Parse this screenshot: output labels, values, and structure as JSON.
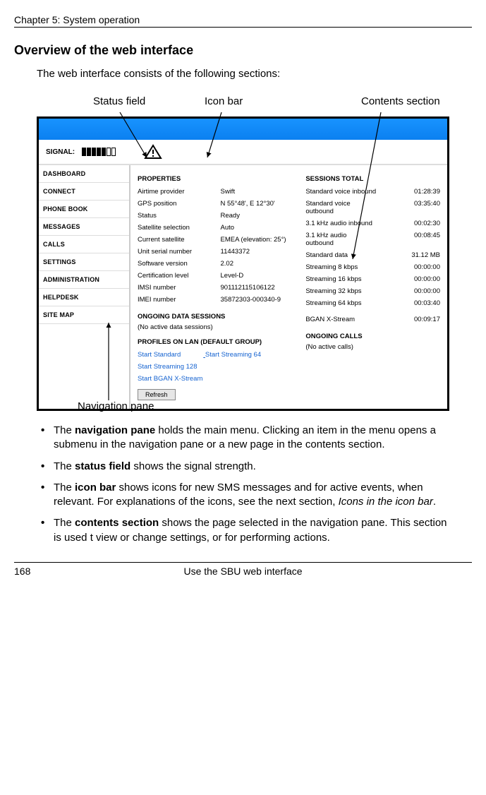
{
  "header": {
    "chapter": "Chapter 5:  System operation"
  },
  "heading": "Overview of the web interface",
  "intro": "The web interface consists of the following sections:",
  "callouts": {
    "status": "Status field",
    "iconbar": "Icon bar",
    "contents": "Contents section",
    "navpane": "Navigation pane"
  },
  "ui": {
    "signal_label": "SIGNAL:",
    "nav": [
      "DASHBOARD",
      "CONNECT",
      "PHONE BOOK",
      "MESSAGES",
      "CALLS",
      "SETTINGS",
      "ADMINISTRATION",
      "HELPDESK",
      "SITE MAP"
    ],
    "properties": {
      "header": "PROPERTIES",
      "rows": [
        {
          "k": "Airtime provider",
          "v": "Swift"
        },
        {
          "k": "GPS position",
          "v": "N 55°48', E 12°30'"
        },
        {
          "k": "Status",
          "v": "Ready"
        },
        {
          "k": "Satellite selection",
          "v": "Auto"
        },
        {
          "k": "Current satellite",
          "v": "EMEA (elevation: 25°)"
        },
        {
          "k": "Unit serial number",
          "v": "11443372"
        },
        {
          "k": "Software version",
          "v": "2.02"
        },
        {
          "k": "Certification level",
          "v": "Level-D"
        },
        {
          "k": "IMSI number",
          "v": "901112115106122"
        },
        {
          "k": "IMEI number",
          "v": "35872303-000340-9"
        }
      ]
    },
    "sessions": {
      "header": "SESSIONS TOTAL",
      "rows": [
        {
          "k": "Standard voice inbound",
          "v": "01:28:39"
        },
        {
          "k": "Standard voice outbound",
          "v": "03:35:40"
        },
        {
          "k": "3.1 kHz audio inbound",
          "v": "00:02:30"
        },
        {
          "k": "3.1 kHz audio outbound",
          "v": "00:08:45"
        },
        {
          "k": "Standard data",
          "v": "31.12 MB"
        },
        {
          "k": "Streaming 8 kbps",
          "v": "00:00:00"
        },
        {
          "k": "Streaming 16 kbps",
          "v": "00:00:00"
        },
        {
          "k": "Streaming 32 kbps",
          "v": "00:00:00"
        },
        {
          "k": "Streaming 64 kbps",
          "v": "00:03:40"
        },
        {
          "k": "",
          "v": ""
        },
        {
          "k": "BGAN X-Stream",
          "v": "00:09:17"
        }
      ]
    },
    "ongoing_data": {
      "header": "ONGOING DATA SESSIONS",
      "text": "(No active data sessions)"
    },
    "ongoing_calls": {
      "header": "ONGOING CALLS",
      "text": "(No active calls)"
    },
    "profiles_header": "PROFILES ON LAN (DEFAULT GROUP)",
    "links": [
      "Start Standard",
      "Start Streaming 64",
      "Start Streaming 128",
      "Start BGAN X-Stream"
    ],
    "refresh": "Refresh"
  },
  "bullets": {
    "b1a": "The ",
    "b1b": "navigation pane",
    "b1c": " holds the main menu. Clicking an item in the menu opens a submenu in the navigation pane or a new page in the contents section.",
    "b2a": "The ",
    "b2b": "status field",
    "b2c": " shows the signal strength.",
    "b3a": "The ",
    "b3b": "icon bar",
    "b3c": " shows icons for new SMS messages and for active events, when relevant. For explanations of the icons, see the next section, ",
    "b3d": "Icons in the icon bar",
    "b3e": ".",
    "b4a": "The ",
    "b4b": "contents section",
    "b4c": " shows the page selected in the navigation pane. This section is used t view or change settings, or for performing actions."
  },
  "footer": {
    "page": "168",
    "title": "Use the SBU web interface"
  }
}
